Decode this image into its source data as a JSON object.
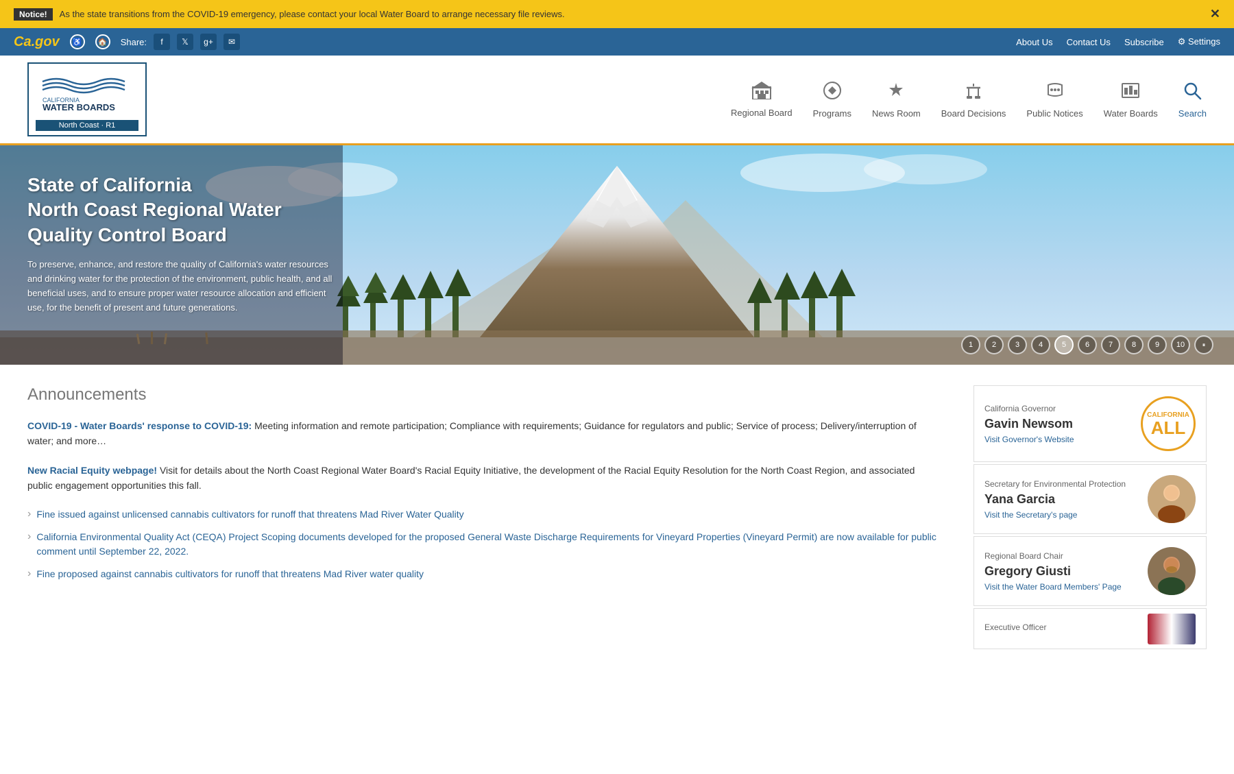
{
  "notice": {
    "label": "Notice!",
    "text": "As the state transitions from the COVID-19 emergency, please contact your local Water Board to arrange necessary file reviews."
  },
  "utility": {
    "share_label": "Share:",
    "links": [
      {
        "label": "About Us",
        "id": "about-us"
      },
      {
        "label": "Contact Us",
        "id": "contact-us"
      },
      {
        "label": "Subscribe",
        "id": "subscribe"
      },
      {
        "label": "Settings",
        "id": "settings"
      }
    ]
  },
  "header": {
    "logo": {
      "ca_text": "CALIFORNIA",
      "water_boards": "WATER BOARDS",
      "north_coast": "North Coast · R1"
    },
    "nav": [
      {
        "label": "Regional Board",
        "icon": "🏛"
      },
      {
        "label": "Programs",
        "icon": "🔄"
      },
      {
        "label": "News Room",
        "icon": "📢"
      },
      {
        "label": "Board Decisions",
        "icon": "⚖"
      },
      {
        "label": "Public Notices",
        "icon": "💬"
      },
      {
        "label": "Water Boards",
        "icon": "🏢"
      },
      {
        "label": "Search",
        "icon": "🔍",
        "active": true
      }
    ]
  },
  "hero": {
    "title": "State of California\nNorth Coast Regional Water Quality Control Board",
    "description": "To preserve, enhance, and restore the quality of California's water resources and drinking water for the protection of the environment, public health, and all beneficial uses, and to ensure proper water resource allocation and efficient use, for the benefit of present and future generations.",
    "pagination": [
      "1",
      "2",
      "3",
      "4",
      "5",
      "6",
      "7",
      "8",
      "9",
      "10",
      "⏸"
    ],
    "active_page": 5
  },
  "announcements": {
    "heading": "Announcements",
    "items": [
      {
        "link_text": "COVID-19 - Water Boards' response to COVID-19:",
        "body": " Meeting information and remote participation; Compliance with requirements; Guidance for regulators and public; Service of process; Delivery/interruption of water; and more…"
      },
      {
        "link_text": "New Racial Equity webpage!",
        "body": " Visit for details about the North Coast Regional Water Board's Racial Equity Initiative, the development of the Racial Equity Resolution for the North Coast Region, and associated public engagement opportunities this fall."
      }
    ],
    "bullets": [
      "Fine issued against unlicensed cannabis cultivators for runoff that threatens Mad River Water Quality",
      "California Environmental Quality Act (CEQA) Project Scoping documents developed for the proposed General Waste Discharge Requirements for Vineyard Properties (Vineyard Permit) are now available for public comment until September 22, 2022.",
      "Fine proposed against cannabis cultivators for runoff that threatens Mad River water quality"
    ]
  },
  "sidebar": {
    "cards": [
      {
        "label": "California Governor",
        "name": "Gavin Newsom",
        "link": "Visit Governor's Website",
        "avatar_type": "ca_all"
      },
      {
        "label": "Secretary for Environmental Protection",
        "name": "Yana Garcia",
        "link": "Visit the Secretary's page",
        "avatar_type": "photo_female"
      },
      {
        "label": "Regional Board Chair",
        "name": "Gregory Giusti",
        "link": "Visit the Water Board Members' Page",
        "avatar_type": "photo_male"
      },
      {
        "label": "Executive Officer",
        "name": "",
        "link": "",
        "avatar_type": "photo_flag"
      }
    ]
  }
}
